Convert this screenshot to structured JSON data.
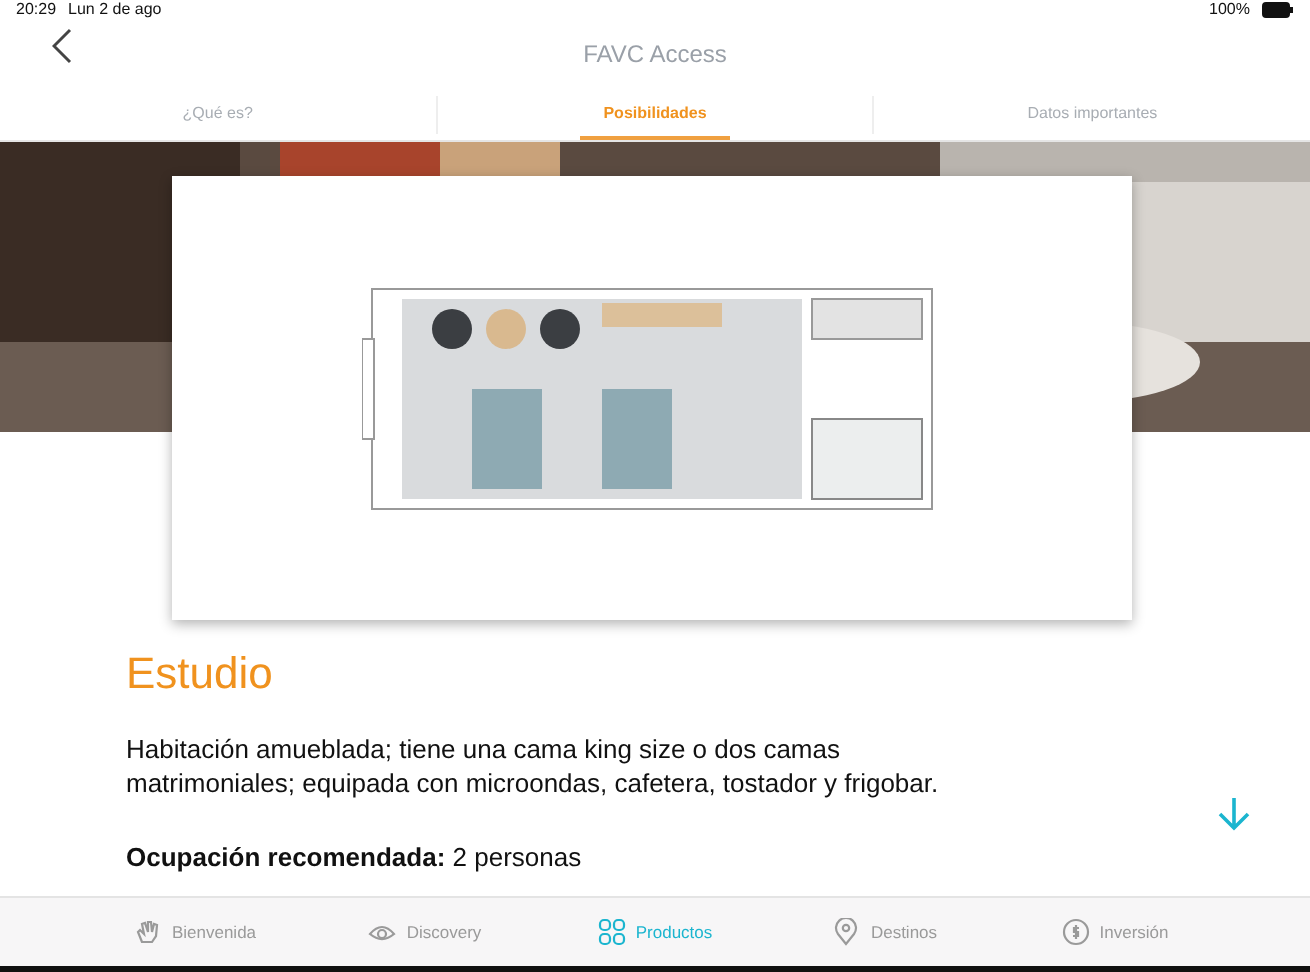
{
  "status_bar": {
    "time": "20:29",
    "date": "Lun 2 de ago",
    "battery": "100%"
  },
  "header": {
    "title": "FAVC Access"
  },
  "tabs": [
    {
      "label": "¿Qué es?",
      "selected": false
    },
    {
      "label": "Posibilidades",
      "selected": true
    },
    {
      "label": "Datos importantes",
      "selected": false
    }
  ],
  "room": {
    "title": "Estudio",
    "description": "Habitación amueblada; tiene una cama king size o dos camas matrimoniales; equipada con microondas, cafetera, tostador y frigobar.",
    "occupancy": "**Ocupación recomendada:** 2 personas"
  },
  "nav": [
    {
      "label": "Bienvenida",
      "kind": "hand",
      "selected": false
    },
    {
      "label": "Discovery",
      "kind": "eye",
      "selected": false
    },
    {
      "label": "Productos",
      "kind": "grid",
      "selected": true
    },
    {
      "label": "Destinos",
      "kind": "pin",
      "selected": false
    },
    {
      "label": "Inversión",
      "kind": "coin",
      "selected": false
    }
  ]
}
